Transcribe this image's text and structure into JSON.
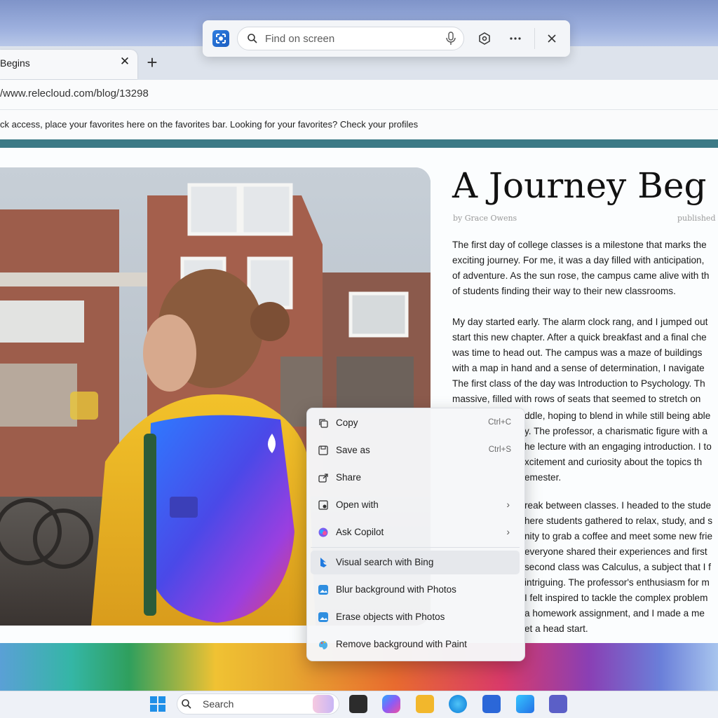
{
  "findbar": {
    "placeholder": "Find on screen",
    "icons": [
      "screen-capture-icon",
      "search-icon",
      "microphone-icon",
      "visual-search-icon",
      "more-icon",
      "close-icon"
    ]
  },
  "browser": {
    "tab_title": "Begins",
    "tab_close": "✕",
    "new_tab": "+",
    "url": "/www.relecloud.com/blog/13298",
    "favorites_message": "ck access, place your favorites here on the favorites bar. Looking for your favorites? Check your profiles"
  },
  "article": {
    "title": "A Journey Beg",
    "byline": "by Grace Owens",
    "published": "published",
    "lines": [
      "The first day of college classes is a milestone that marks the",
      "exciting journey. For me, it was a day filled with anticipation,",
      "of adventure. As the sun rose, the campus came alive with th",
      "of students finding their way to their new classrooms.",
      "",
      "My day started early. The alarm clock rang, and I jumped out",
      "start this new chapter. After a quick breakfast and a final che",
      "was time to head out. The campus was a maze of buildings",
      "with a map in hand and a sense of determination, I navigate",
      "The first class of the day was Introduction to Psychology. Th",
      "massive, filled with rows of seats that seemed to stretch on",
      "",
      "ddle, hoping to blend in while still being able",
      "y. The professor, a charismatic figure with a",
      "he lecture with an engaging introduction. I to",
      "xcitement and curiosity about the topics th",
      "emester.",
      "",
      "reak between classes. I headed to the stude",
      "here students gathered to relax, study, and s",
      "nity to grab a coffee and meet some new frie",
      "everyone shared their experiences and first",
      "second class was Calculus, a subject that I f",
      "intriguing. The professor's enthusiasm for m",
      "I felt inspired to tackle the complex problem",
      "a homework assignment, and I made a me",
      "et a head start."
    ]
  },
  "context_menu": {
    "items": [
      {
        "label": "Copy",
        "shortcut": "Ctrl+C",
        "icon": "copy-icon"
      },
      {
        "label": "Save as",
        "shortcut": "Ctrl+S",
        "icon": "save-icon"
      },
      {
        "label": "Share",
        "shortcut": "",
        "icon": "share-icon"
      },
      {
        "label": "Open with",
        "shortcut": "",
        "icon": "open-with-icon",
        "submenu": true
      },
      {
        "label": "Ask Copilot",
        "shortcut": "",
        "icon": "copilot-icon",
        "submenu": true
      },
      {
        "label": "Visual search with Bing",
        "shortcut": "",
        "icon": "bing-icon",
        "highlighted": true
      },
      {
        "label": "Blur background with Photos",
        "shortcut": "",
        "icon": "photos-icon"
      },
      {
        "label": "Erase objects with Photos",
        "shortcut": "",
        "icon": "photos-icon"
      },
      {
        "label": "Remove background with Paint",
        "shortcut": "",
        "icon": "paint-icon"
      }
    ],
    "chevron": "›"
  },
  "taskbar": {
    "search_placeholder": "Search",
    "apps": [
      "windows-start-icon",
      "task-view-icon",
      "copilot-icon",
      "file-explorer-icon",
      "edge-icon",
      "store-icon",
      "app-icon",
      "teams-icon"
    ]
  },
  "colors": {
    "accent_teal": "#3c7a86",
    "menu_highlight": "#e6e8ec"
  }
}
